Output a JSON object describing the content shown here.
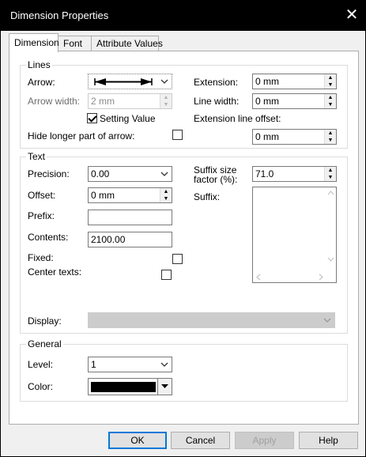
{
  "window": {
    "title": "Dimension Properties",
    "close_glyph": "✕"
  },
  "tabs": [
    {
      "label": "Dimension",
      "active": true
    },
    {
      "label": "Font",
      "active": false
    },
    {
      "label": "Attribute Values",
      "active": false
    }
  ],
  "lines": {
    "legend": "Lines",
    "arrow_label": "Arrow:",
    "arrow_width_label": "Arrow width:",
    "arrow_width_value": "2 mm",
    "setting_value_label": "Setting Value",
    "setting_value_checked": true,
    "hide_longer_label": "Hide longer part of arrow:",
    "hide_longer_checked": false,
    "extension_label": "Extension:",
    "extension_value": "0 mm",
    "line_width_label": "Line width:",
    "line_width_value": "0 mm",
    "ext_offset_label": "Extension line offset:",
    "ext_offset_value": "0 mm"
  },
  "text": {
    "legend": "Text",
    "precision_label": "Precision:",
    "precision_value": "0.00",
    "offset_label": "Offset:",
    "offset_value": "0 mm",
    "prefix_label": "Prefix:",
    "prefix_value": "",
    "contents_label": "Contents:",
    "contents_value": "2100.00",
    "fixed_label": "Fixed:",
    "fixed_checked": false,
    "center_label": "Center texts:",
    "center_checked": false,
    "suffix_size_label_1": "Suffix size",
    "suffix_size_label_2": "factor (%):",
    "suffix_size_value": "71.0",
    "suffix_label": "Suffix:",
    "suffix_value": "",
    "display_label": "Display:",
    "display_value": ""
  },
  "general": {
    "legend": "General",
    "level_label": "Level:",
    "level_value": "1",
    "color_label": "Color:",
    "color_value": "#000000"
  },
  "buttons": {
    "ok": "OK",
    "cancel": "Cancel",
    "apply": "Apply",
    "help": "Help"
  },
  "colors": {
    "accent": "#0078d7",
    "titlebar": "#000000"
  }
}
